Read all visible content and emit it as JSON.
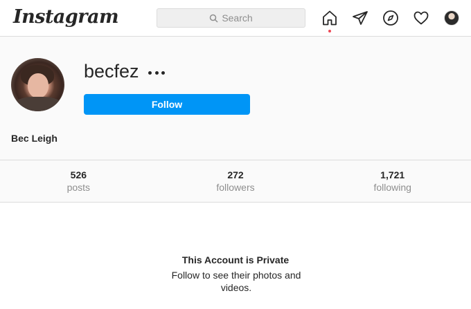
{
  "topnav": {
    "logo": "Instagram",
    "search": {
      "placeholder": "Search"
    },
    "icons": [
      "home-icon",
      "direct-icon",
      "explore-icon",
      "activity-heart-icon",
      "profile-avatar"
    ],
    "home_notification_color": "#ed4956"
  },
  "profile": {
    "username": "becfez",
    "follow_label": "Follow",
    "full_name": "Bec Leigh",
    "accent_color": "#0095f6"
  },
  "stats": [
    {
      "value": "526",
      "label": "posts"
    },
    {
      "value": "272",
      "label": "followers"
    },
    {
      "value": "1,721",
      "label": "following"
    }
  ],
  "private_notice": {
    "title": "This Account is Private",
    "text": "Follow to see their photos and videos."
  }
}
